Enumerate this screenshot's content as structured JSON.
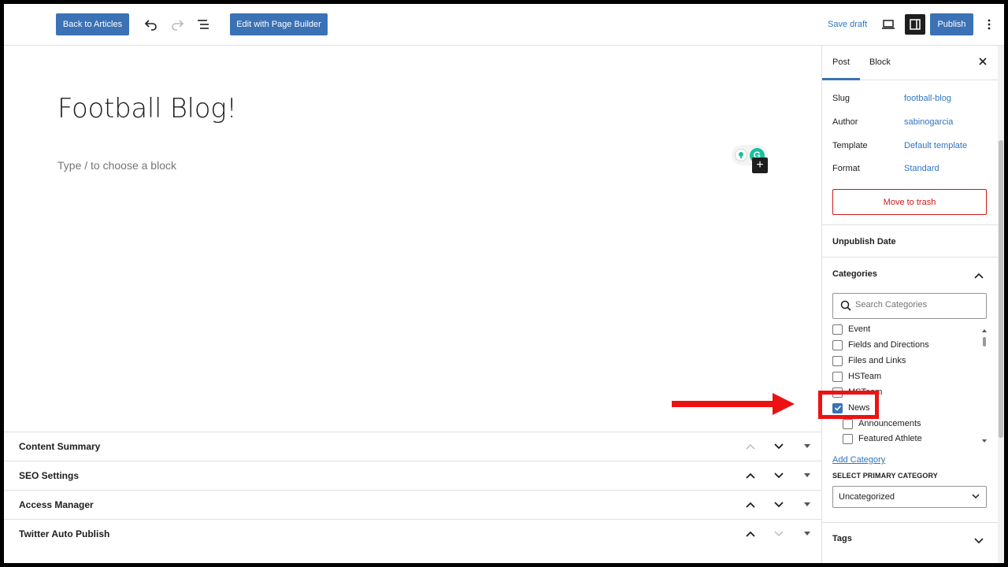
{
  "toolbar": {
    "back_label": "Back to Articles",
    "page_builder_label": "Edit with Page Builder",
    "save_draft_label": "Save draft",
    "publish_label": "Publish"
  },
  "editor": {
    "post_title": "Football Blog!",
    "block_placeholder": "Type / to choose a block"
  },
  "metaboxes": [
    {
      "label": "Content Summary"
    },
    {
      "label": "SEO Settings"
    },
    {
      "label": "Access Manager"
    },
    {
      "label": "Twitter Auto Publish"
    }
  ],
  "sidebar": {
    "tabs": [
      "Post",
      "Block"
    ],
    "active_tab": "Post",
    "rows": [
      {
        "label": "Slug",
        "value": "football-blog"
      },
      {
        "label": "Author",
        "value": "sabinogarcia"
      },
      {
        "label": "Template",
        "value": "Default template"
      },
      {
        "label": "Format",
        "value": "Standard"
      }
    ],
    "trash_label": "Move to trash",
    "unpublish_title": "Unpublish Date",
    "categories_title": "Categories",
    "search_placeholder": "Search Categories",
    "categories": [
      {
        "label": "Event",
        "checked": false,
        "child": false
      },
      {
        "label": "Fields and Directions",
        "checked": false,
        "child": false
      },
      {
        "label": "Files and Links",
        "checked": false,
        "child": false
      },
      {
        "label": "HSTeam",
        "checked": false,
        "child": false
      },
      {
        "label": "MSTeam",
        "checked": false,
        "child": false
      },
      {
        "label": "News",
        "checked": true,
        "child": false
      },
      {
        "label": "Announcements",
        "checked": false,
        "child": true
      },
      {
        "label": "Featured Athlete",
        "checked": false,
        "child": true
      }
    ],
    "add_category_label": "Add Category",
    "primary_category_label": "SELECT PRIMARY CATEGORY",
    "primary_category_value": "Uncategorized",
    "tags_title": "Tags"
  },
  "colors": {
    "accent": "#3a72b5",
    "link": "#2f74c3",
    "danger": "#cc1818",
    "annotation": "#ee1111"
  }
}
